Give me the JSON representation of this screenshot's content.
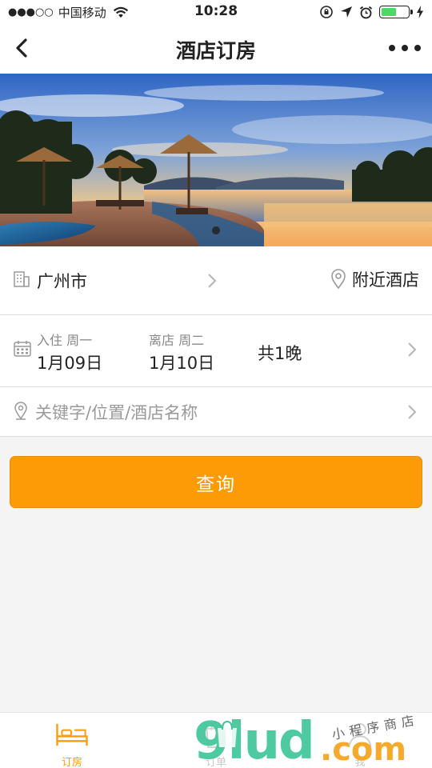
{
  "status_bar": {
    "signal_dots": "●●●○○",
    "carrier": "中国移动",
    "time": "10:28"
  },
  "nav": {
    "title": "酒店订房"
  },
  "city_row": {
    "city": "广州市",
    "nearby": "附近酒店"
  },
  "date_row": {
    "checkin_label": "入住 周一",
    "checkin_date": "1月09日",
    "checkout_label": "离店 周二",
    "checkout_date": "1月10日",
    "nights": "共1晚"
  },
  "keyword_row": {
    "placeholder": "关键字/位置/酒店名称"
  },
  "search_button": {
    "label": "查询"
  },
  "tab_bar": {
    "tabs": [
      {
        "label": "订房",
        "icon": "bed-icon",
        "active": true
      },
      {
        "label": "订单",
        "icon": "shopping-bag-icon",
        "active": false
      },
      {
        "label": "我",
        "icon": "person-icon",
        "active": false
      }
    ]
  },
  "watermark": {
    "brand": "9lud",
    "domain": ".com",
    "tagline": "小程序商店"
  },
  "colors": {
    "accent": "#fd9b07",
    "battery_fill": "#4cd964",
    "divider": "#dcdcdc",
    "page_background": "#f4f4f4"
  },
  "banner": {
    "slide_count": 1,
    "active_slide": 1
  }
}
